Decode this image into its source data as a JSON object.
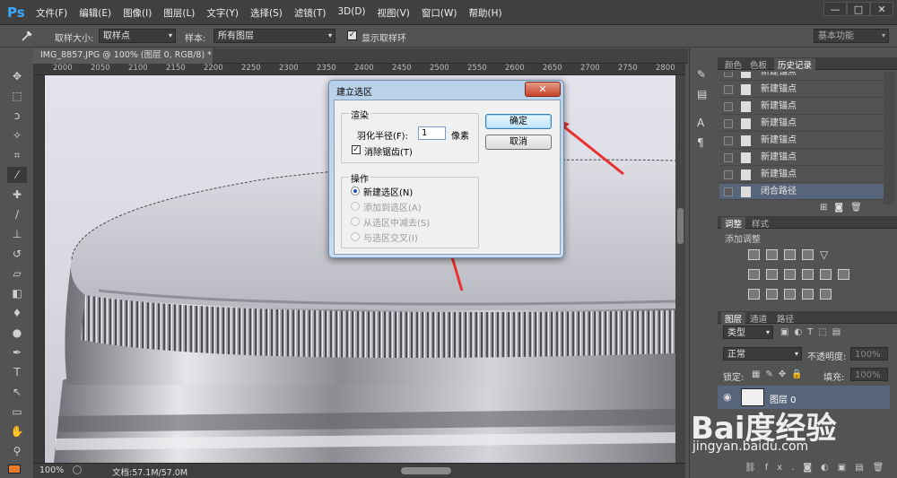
{
  "app": {
    "logo": "Ps"
  },
  "menu": [
    "文件(F)",
    "编辑(E)",
    "图像(I)",
    "图层(L)",
    "文字(Y)",
    "选择(S)",
    "滤镜(T)",
    "3D(D)",
    "视图(V)",
    "窗口(W)",
    "帮助(H)"
  ],
  "window_controls": [
    "—",
    "□",
    "✕"
  ],
  "options": {
    "sample_size_label": "取样大小:",
    "sample_size_value": "取样点",
    "sample_label": "样本:",
    "sample_value": "所有图层",
    "show_ring_label": "显示取样环",
    "workspace": "基本功能"
  },
  "document": {
    "tab_title": "IMG_8857.JPG @ 100% (图层 0, RGB/8) *",
    "tab_close": "×",
    "zoom": "100%",
    "doc_info": "文档:57.1M/57.0M"
  },
  "ruler": [
    "2000",
    "2050",
    "2100",
    "2150",
    "2200",
    "2250",
    "2300",
    "2350",
    "2400",
    "2450",
    "2500",
    "2550",
    "2600",
    "2650",
    "2700",
    "2750",
    "2800"
  ],
  "dialog": {
    "title": "建立选区",
    "close": "✕",
    "render_group": "渲染",
    "feather_label": "羽化半径(F):",
    "feather_value": "1",
    "feather_unit": "像素",
    "antialias_label": "消除锯齿(T)",
    "antialias_checked": true,
    "ops_group": "操作",
    "ops": [
      {
        "label": "新建选区(N)",
        "selected": true,
        "enabled": true
      },
      {
        "label": "添加到选区(A)",
        "selected": false,
        "enabled": false
      },
      {
        "label": "从选区中减去(S)",
        "selected": false,
        "enabled": false
      },
      {
        "label": "与选区交叉(I)",
        "selected": false,
        "enabled": false
      }
    ],
    "ok": "确定",
    "cancel": "取消"
  },
  "panels": {
    "top_tabs": [
      "颜色",
      "色板",
      "历史记录"
    ],
    "history": [
      "新建锚点",
      "新建锚点",
      "新建锚点",
      "新建锚点",
      "新建锚点",
      "新建锚点",
      "新建锚点",
      "闭合路径"
    ],
    "adjust_tabs": [
      "调整",
      "样式"
    ],
    "adjust_title": "添加调整",
    "layer_tabs": [
      "图层",
      "通道",
      "路径"
    ],
    "kind_label": "类型",
    "blend_mode": "正常",
    "opacity_label": "不透明度:",
    "opacity_value": "100%",
    "lock_label": "锁定:",
    "fill_label": "填充:",
    "fill_value": "100%",
    "layer_name": "图层 0",
    "fx": "fx."
  },
  "watermark": {
    "brand": "Bai度经验",
    "url": "jingyan.baidu.com"
  },
  "colors": {
    "accent": "#3ba8ff",
    "arrow": "#e8312d",
    "selection": "#57657a"
  }
}
